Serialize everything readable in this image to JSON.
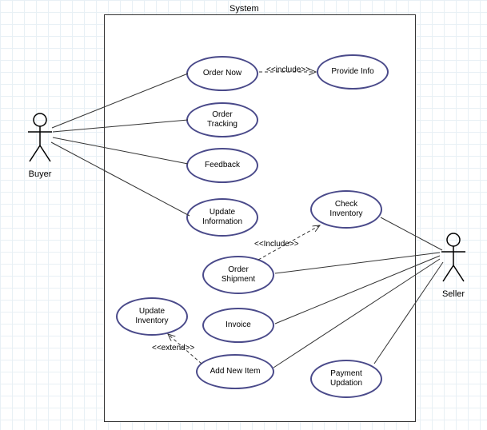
{
  "system": {
    "title": "System"
  },
  "actors": {
    "buyer": "Buyer",
    "seller": "Seller"
  },
  "usecases": {
    "order_now": "Order Now",
    "provide_info": "Provide Info",
    "order_tracking": "Order\nTracking",
    "feedback": "Feedback",
    "update_info": "Update\nInformation",
    "check_inventory": "Check\nInventory",
    "order_shipment": "Order\nShipment",
    "update_inventory": "Update\nInventory",
    "invoice": "Invoice",
    "add_new_item": "Add New Item",
    "payment_updation": "Payment\nUpdation"
  },
  "relations": {
    "include1": "<<include>>",
    "include2": "<<Include>>",
    "extend": "<<extend>>"
  }
}
